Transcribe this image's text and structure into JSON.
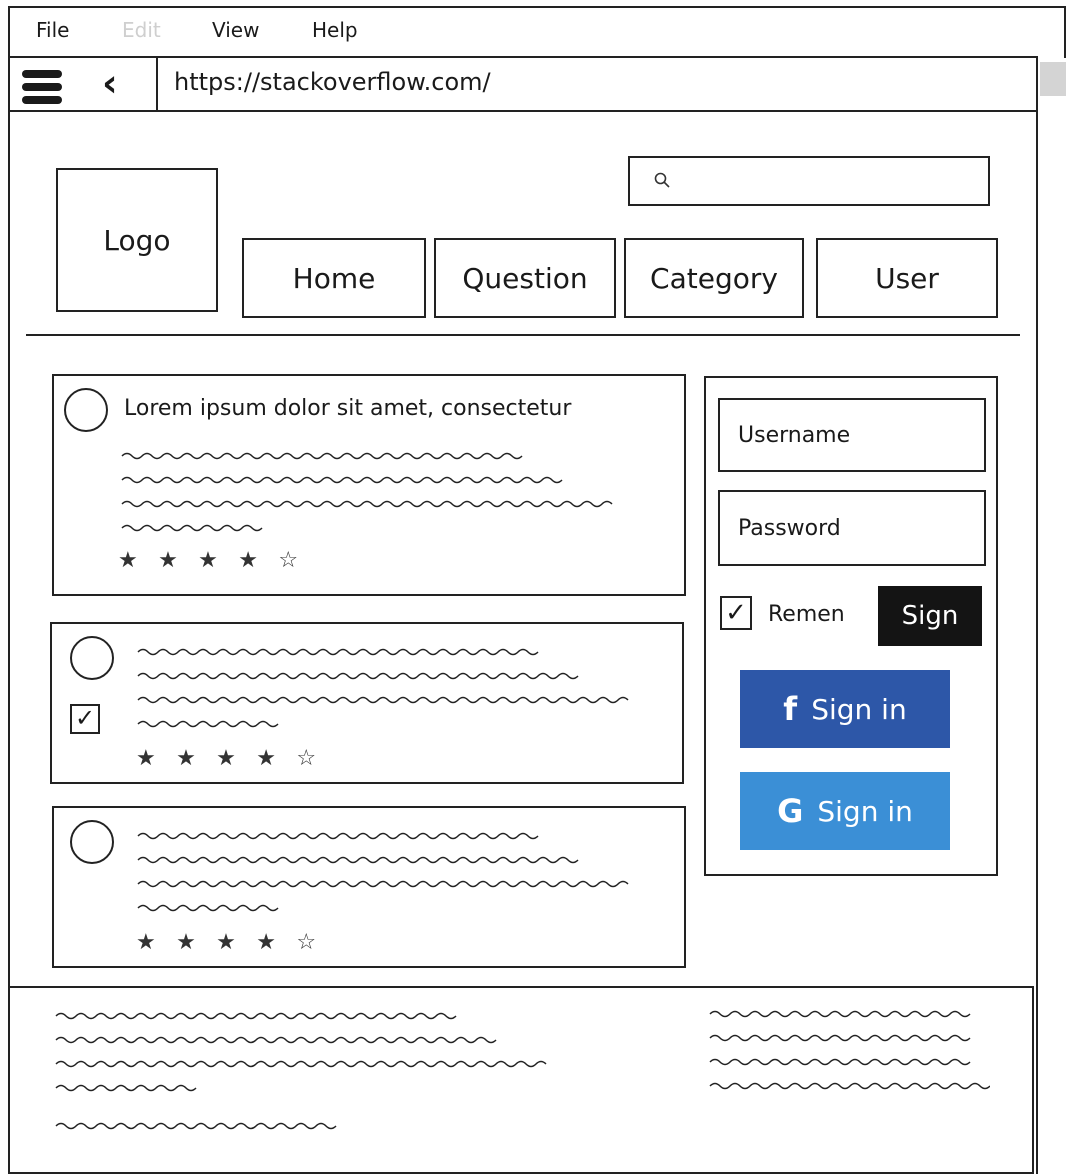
{
  "menu": {
    "items": [
      {
        "label": "File",
        "enabled": true
      },
      {
        "label": "Edit",
        "enabled": false
      },
      {
        "label": "View",
        "enabled": true
      },
      {
        "label": "Help",
        "enabled": true
      }
    ]
  },
  "browser": {
    "url": "https://stackoverflow.com/",
    "menu_icon": "hamburger-icon",
    "back_icon": "chevron-left-icon"
  },
  "header": {
    "logo": "Logo",
    "search_placeholder": "",
    "nav": [
      "Home",
      "Question",
      "Category",
      "User"
    ]
  },
  "questions": [
    {
      "title": "Lorem ipsum dolor sit amet, consectetur",
      "rating": 4,
      "max_rating": 5,
      "checked": false
    },
    {
      "title": "",
      "rating": 4,
      "max_rating": 5,
      "checked": true
    },
    {
      "title": "",
      "rating": 4,
      "max_rating": 5,
      "checked": false
    }
  ],
  "login": {
    "username_placeholder": "Username",
    "password_placeholder": "Password",
    "remember_label": "Remen",
    "remember_checked": true,
    "sign_label": "Sign",
    "facebook_label": "Sign in",
    "facebook_icon": "f",
    "google_label": "Sign in",
    "google_icon": "G"
  },
  "colors": {
    "facebook": "#2d57a8",
    "google": "#3b8fd6",
    "sign_button": "#141414"
  }
}
